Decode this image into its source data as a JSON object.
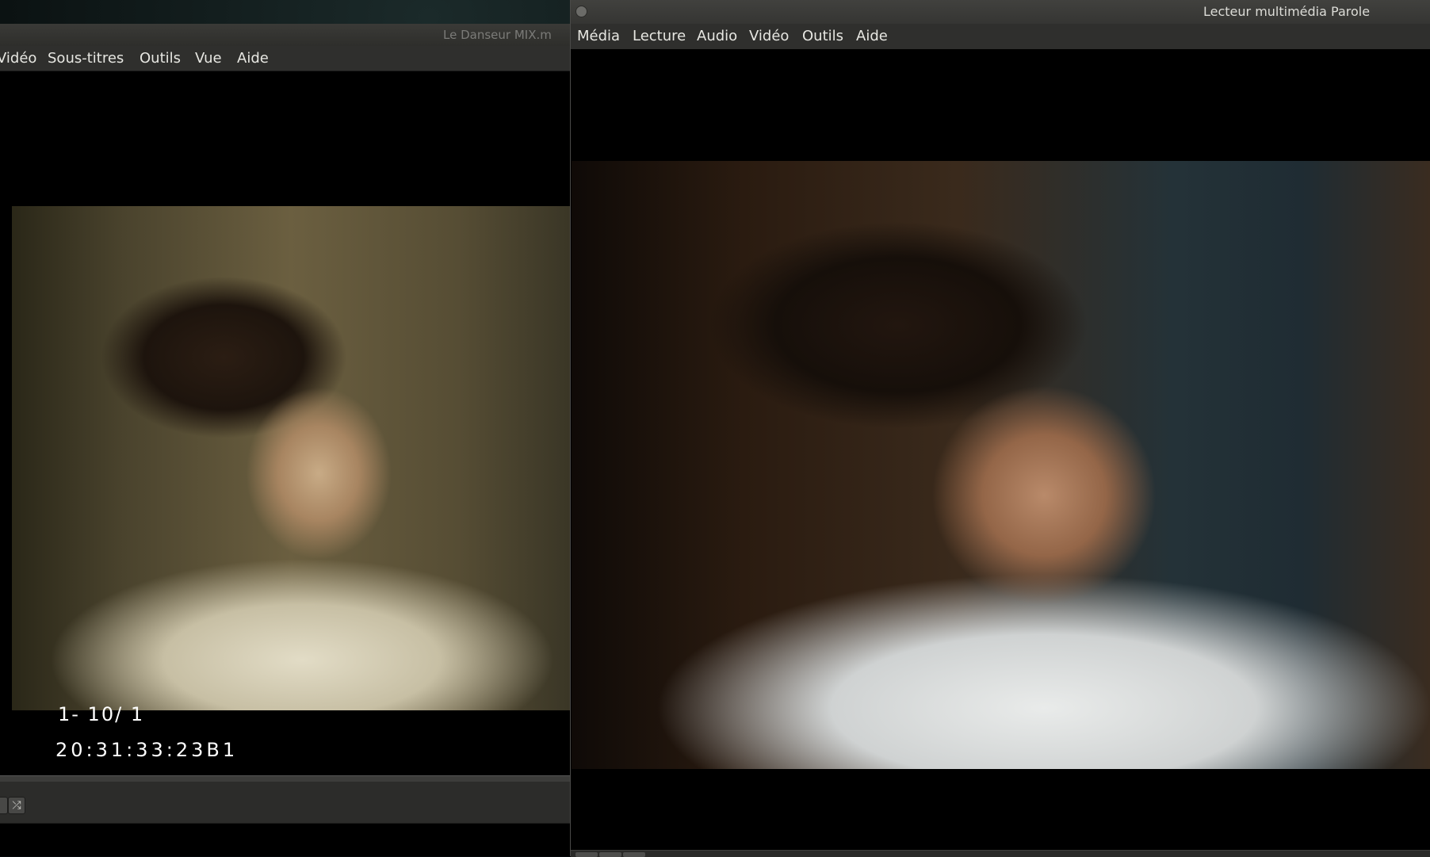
{
  "left_window": {
    "title": "Le Danseur MIX.m",
    "menu": [
      "Vidéo",
      "Sous-titres",
      "Outils",
      "Vue",
      "Aide"
    ],
    "overlay": {
      "line1": "1- 10/ 1",
      "line2": "20:31:33:23B1"
    },
    "icons": [
      "shuffle-icon"
    ]
  },
  "right_window": {
    "title": "Lecteur multimédia Parole",
    "menu": [
      "Média",
      "Lecture",
      "Audio",
      "Vidéo",
      "Outils",
      "Aide"
    ]
  }
}
